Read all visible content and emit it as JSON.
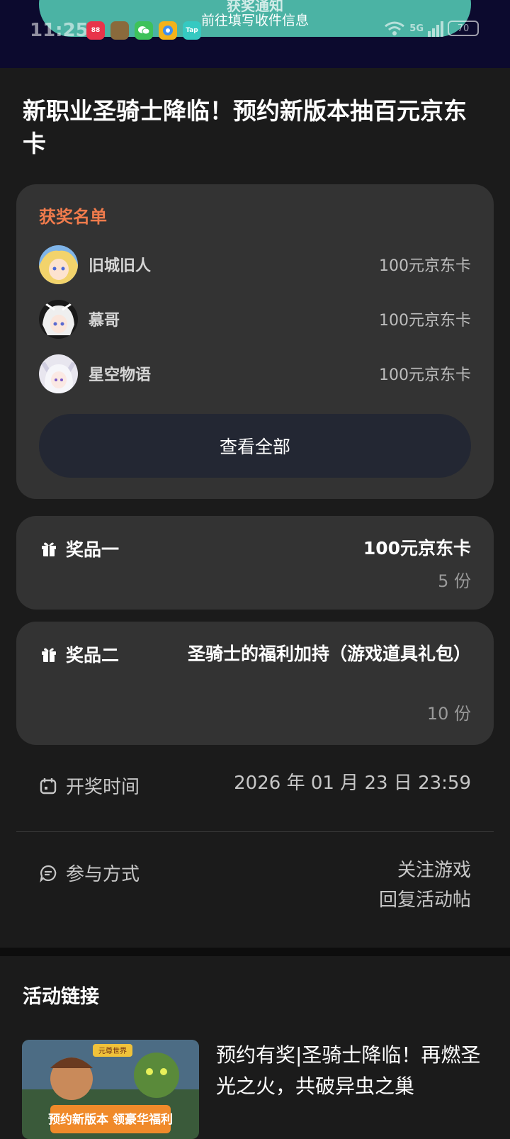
{
  "status_bar": {
    "time": "11:25",
    "network": "5G",
    "battery": "70",
    "apps": [
      {
        "name": "app-red-icon",
        "color": "#e8344a",
        "label": "88"
      },
      {
        "name": "game-icon",
        "color": "#8a6a3c",
        "label": ""
      },
      {
        "name": "wechat-icon",
        "color": "#3ec25a",
        "label": ""
      },
      {
        "name": "browser-icon",
        "color": "#f3b21a",
        "label": ""
      },
      {
        "name": "taptap-icon",
        "color": "#35c9c1",
        "label": "Tap"
      }
    ]
  },
  "toast": {
    "title": "获奖通知",
    "subtitle": "前往填写收件信息",
    "color": "#4bb3a4"
  },
  "page": {
    "title": "新职业圣骑士降临！预约新版本抽百元京东卡"
  },
  "winners": {
    "title": "获奖名单",
    "title_color": "#f07b4c",
    "items": [
      {
        "name": "旧城旧人",
        "prize": "100元京东卡"
      },
      {
        "name": "慕哥",
        "prize": "100元京东卡"
      },
      {
        "name": "星空物语",
        "prize": "100元京东卡"
      }
    ],
    "view_all_label": "查看全部"
  },
  "prizes": [
    {
      "label": "奖品一",
      "name": "100元京东卡",
      "quantity": "5 份"
    },
    {
      "label": "奖品二",
      "name": "圣骑士的福利加持（游戏道具礼包）",
      "quantity": "10 份"
    }
  ],
  "draw": {
    "label": "开奖时间",
    "value": "2026 年 01 月 23 日 23:59"
  },
  "participation": {
    "label": "参与方式",
    "methods": [
      "关注游戏",
      "回复活动帖"
    ]
  },
  "links": {
    "title": "活动链接",
    "article_title": "预约有奖|圣骑士降临！再燃圣光之火，共破异虫之巢",
    "thumb_badge": "元尊世界",
    "thumb_caption": "预约新版本 领豪华福利"
  }
}
